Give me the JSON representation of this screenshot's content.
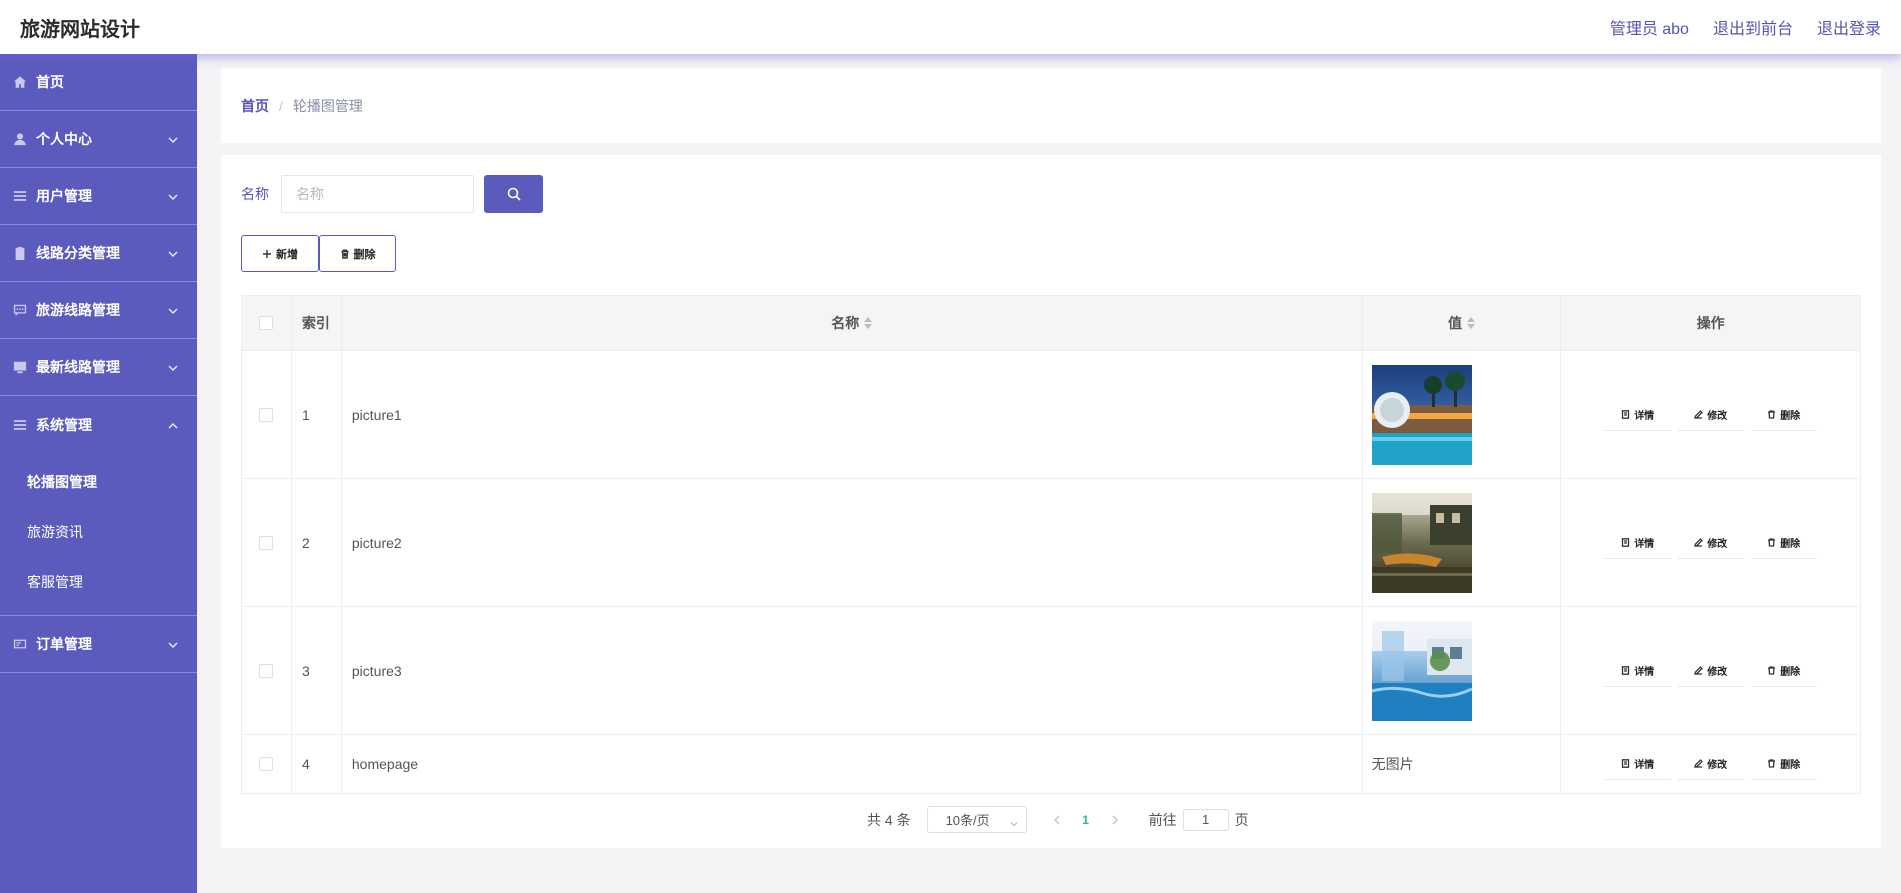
{
  "header": {
    "brand": "旅游网站设计",
    "links": [
      "管理员 abo",
      "退出到前台",
      "退出登录"
    ]
  },
  "sidebar": {
    "items": [
      {
        "label": "首页",
        "icon": "home-icon"
      },
      {
        "label": "个人中心",
        "icon": "user-icon"
      },
      {
        "label": "用户管理",
        "icon": "list-icon"
      },
      {
        "label": "线路分类管理",
        "icon": "clipboard-icon"
      },
      {
        "label": "旅游线路管理",
        "icon": "chat-icon"
      },
      {
        "label": "最新线路管理",
        "icon": "monitor-icon"
      },
      {
        "label": "系统管理",
        "icon": "list-icon"
      },
      {
        "label": "订单管理",
        "icon": "card-icon"
      }
    ],
    "system_submenu": [
      "轮播图管理",
      "旅游资讯",
      "客服管理"
    ],
    "active_sub": "轮播图管理"
  },
  "breadcrumb": {
    "home": "首页",
    "separator": "/",
    "current": "轮播图管理"
  },
  "search": {
    "label": "名称",
    "placeholder": "名称",
    "value": ""
  },
  "actions": {
    "add": "新增",
    "delete": "删除"
  },
  "table": {
    "columns": [
      "索引",
      "名称",
      "值",
      "操作"
    ],
    "rows": [
      {
        "index": "1",
        "name": "picture1",
        "value_type": "image",
        "value_text": "",
        "image_theme": "night-resort"
      },
      {
        "index": "2",
        "name": "picture2",
        "value_type": "image",
        "value_text": "",
        "image_theme": "water-town"
      },
      {
        "index": "3",
        "name": "picture3",
        "value_type": "image",
        "value_text": "",
        "image_theme": "blue-pool"
      },
      {
        "index": "4",
        "name": "homepage",
        "value_type": "text",
        "value_text": "无图片",
        "image_theme": ""
      }
    ],
    "row_ops": [
      "详情",
      "修改",
      "删除"
    ]
  },
  "pagination": {
    "total": "共 4 条",
    "page_size": "10条/页",
    "current_page": "1",
    "goto_prefix": "前往",
    "goto_value": "1",
    "goto_suffix": "页"
  },
  "colors": {
    "accent": "#5b5bbd",
    "brand_link": "#5455b3",
    "page_active": "#2dbd8a"
  }
}
